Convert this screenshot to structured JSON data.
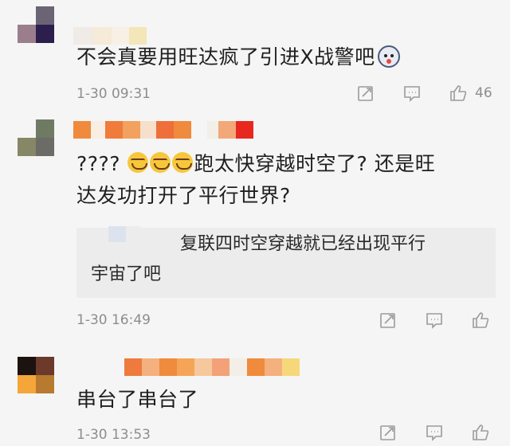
{
  "comments": [
    {
      "text": "不会真要用旺达疯了引进X战警吧",
      "emoji_after": "dog-face-emoji",
      "timestamp": "1-30 09:31",
      "like_count": "46"
    },
    {
      "text_prefix": "????",
      "emoji_count": 3,
      "text_line1": "跑太快穿越时空了? 还是旺",
      "text_line2": "达发功打开了平行世界?",
      "reply": {
        "line1": "复联四时空穿越就已经出现平行",
        "line2": "宇宙了吧"
      },
      "timestamp": "1-30 16:49",
      "like_count": ""
    },
    {
      "text": "串台了串台了",
      "timestamp": "1-30 13:53",
      "like_count": ""
    }
  ],
  "colors": {
    "background": "#f5f5f5",
    "meta_text": "#8d8d8d",
    "reply_bg": "#ececec"
  }
}
